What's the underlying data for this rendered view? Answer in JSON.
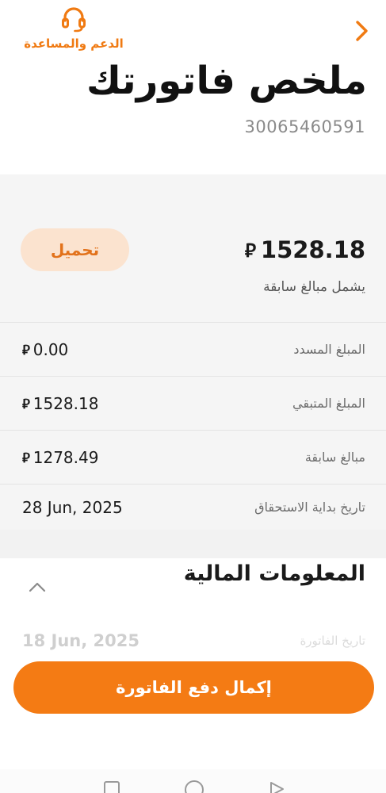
{
  "header": {
    "support_label": "الدعم والمساعدة",
    "support_icon": "headset-icon",
    "back_icon": "chevron-right-icon",
    "title": "ملخص فاتورتك",
    "account_number": "30065460591"
  },
  "summary": {
    "currency_symbol": "⃁",
    "total_amount": "1528.18",
    "includes_text": "يشمل مبالغ سابقة",
    "download_label": "تحميل",
    "rows": [
      {
        "label": "المبلغ المسدد",
        "value": "0.00",
        "has_currency": true
      },
      {
        "label": "المبلغ المتبقي",
        "value": "1528.18",
        "has_currency": true
      },
      {
        "label": "مبالغ سابقة",
        "value": "1278.49",
        "has_currency": true
      },
      {
        "label": "تاريخ بداية الاستحقاق",
        "value": "28 Jun, 2025",
        "has_currency": false
      }
    ]
  },
  "financial": {
    "title": "المعلومات المالية",
    "collapse_icon": "chevron-up-icon",
    "invoice_date_label": "تاريخ الفاتورة",
    "invoice_date_value": "18 Jun, 2025"
  },
  "pay_button_label": "إكمال دفع الفاتورة",
  "colors": {
    "accent": "#f47b14",
    "download_bg": "#fbe3cf",
    "card_bg": "#f5f5f5"
  }
}
